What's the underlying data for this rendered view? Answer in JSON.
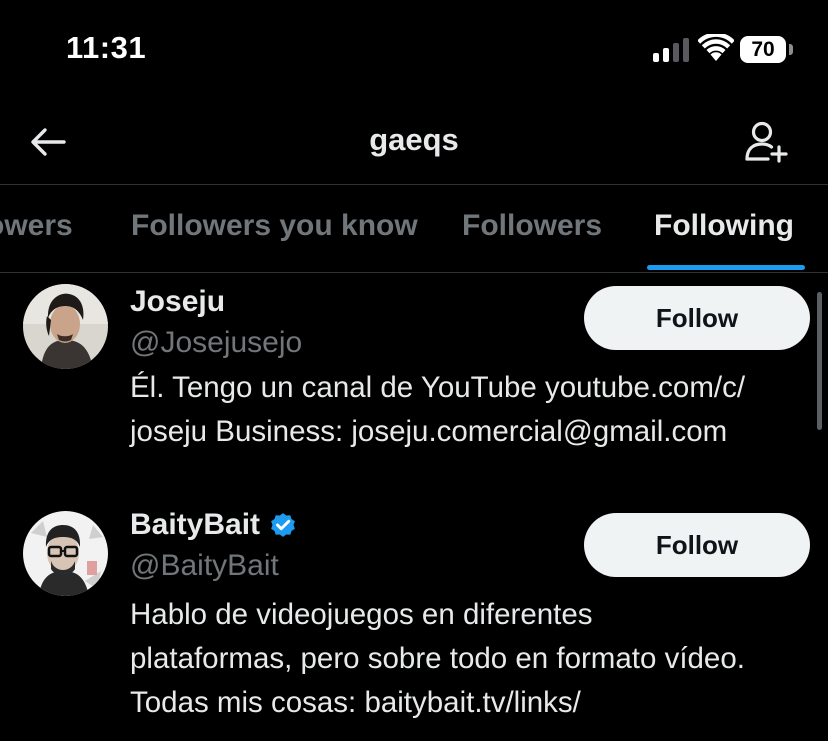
{
  "status_bar": {
    "time": "11:31",
    "battery": "70",
    "icons": [
      "signal-icon",
      "wifi-icon",
      "battery-icon"
    ]
  },
  "header": {
    "title": "gaeqs",
    "back_icon": "arrow-left-icon",
    "add_user_icon": "person-add-icon"
  },
  "tabs": [
    {
      "label": "owers",
      "active": false
    },
    {
      "label": "Followers you know",
      "active": false
    },
    {
      "label": "Followers",
      "active": false
    },
    {
      "label": "Following",
      "active": true
    }
  ],
  "accent_color": "#1d9bf0",
  "users": [
    {
      "name": "Joseju",
      "handle": "@Josejusejo",
      "verified": false,
      "bio_lines": [
        "Él. Tengo un canal de YouTube youtube.com/c/",
        "joseju Business: joseju.comercial@gmail.com"
      ],
      "follow_label": "Follow"
    },
    {
      "name": "BaityBait",
      "handle": "@BaityBait",
      "verified": true,
      "bio_lines": [
        "Hablo de videojuegos en diferentes",
        "plataformas, pero sobre todo en formato vídeo.",
        "Todas mis cosas: baitybait.tv/links/"
      ],
      "follow_label": "Follow"
    }
  ]
}
